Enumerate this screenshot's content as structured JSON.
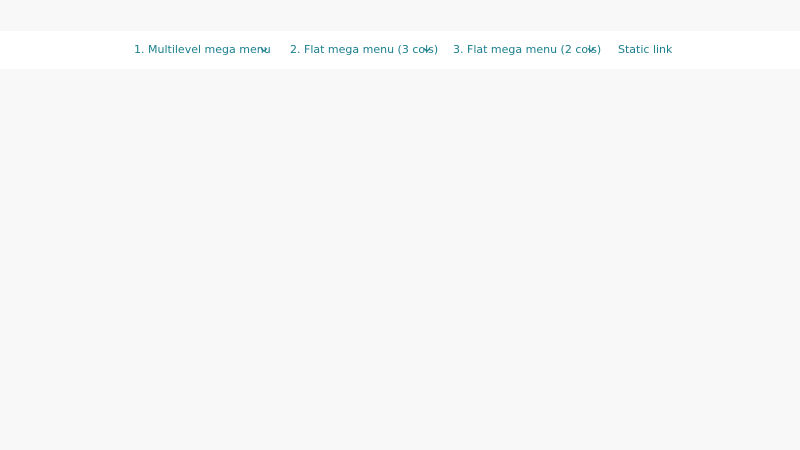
{
  "nav": {
    "items": [
      {
        "label": "1. Multilevel mega menu",
        "has_dropdown": true,
        "icon": "chevron-down-icon"
      },
      {
        "label": "2. Flat mega menu (3 cols)",
        "has_dropdown": true,
        "icon": "chevron-down-icon"
      },
      {
        "label": "3. Flat mega menu (2 cols)",
        "has_dropdown": true,
        "icon": "chevron-down-icon"
      },
      {
        "label": "Static link",
        "has_dropdown": false
      }
    ]
  },
  "colors": {
    "background": "#f8f8f8",
    "navbar": "#ffffff",
    "link": "#1b7f8c"
  }
}
